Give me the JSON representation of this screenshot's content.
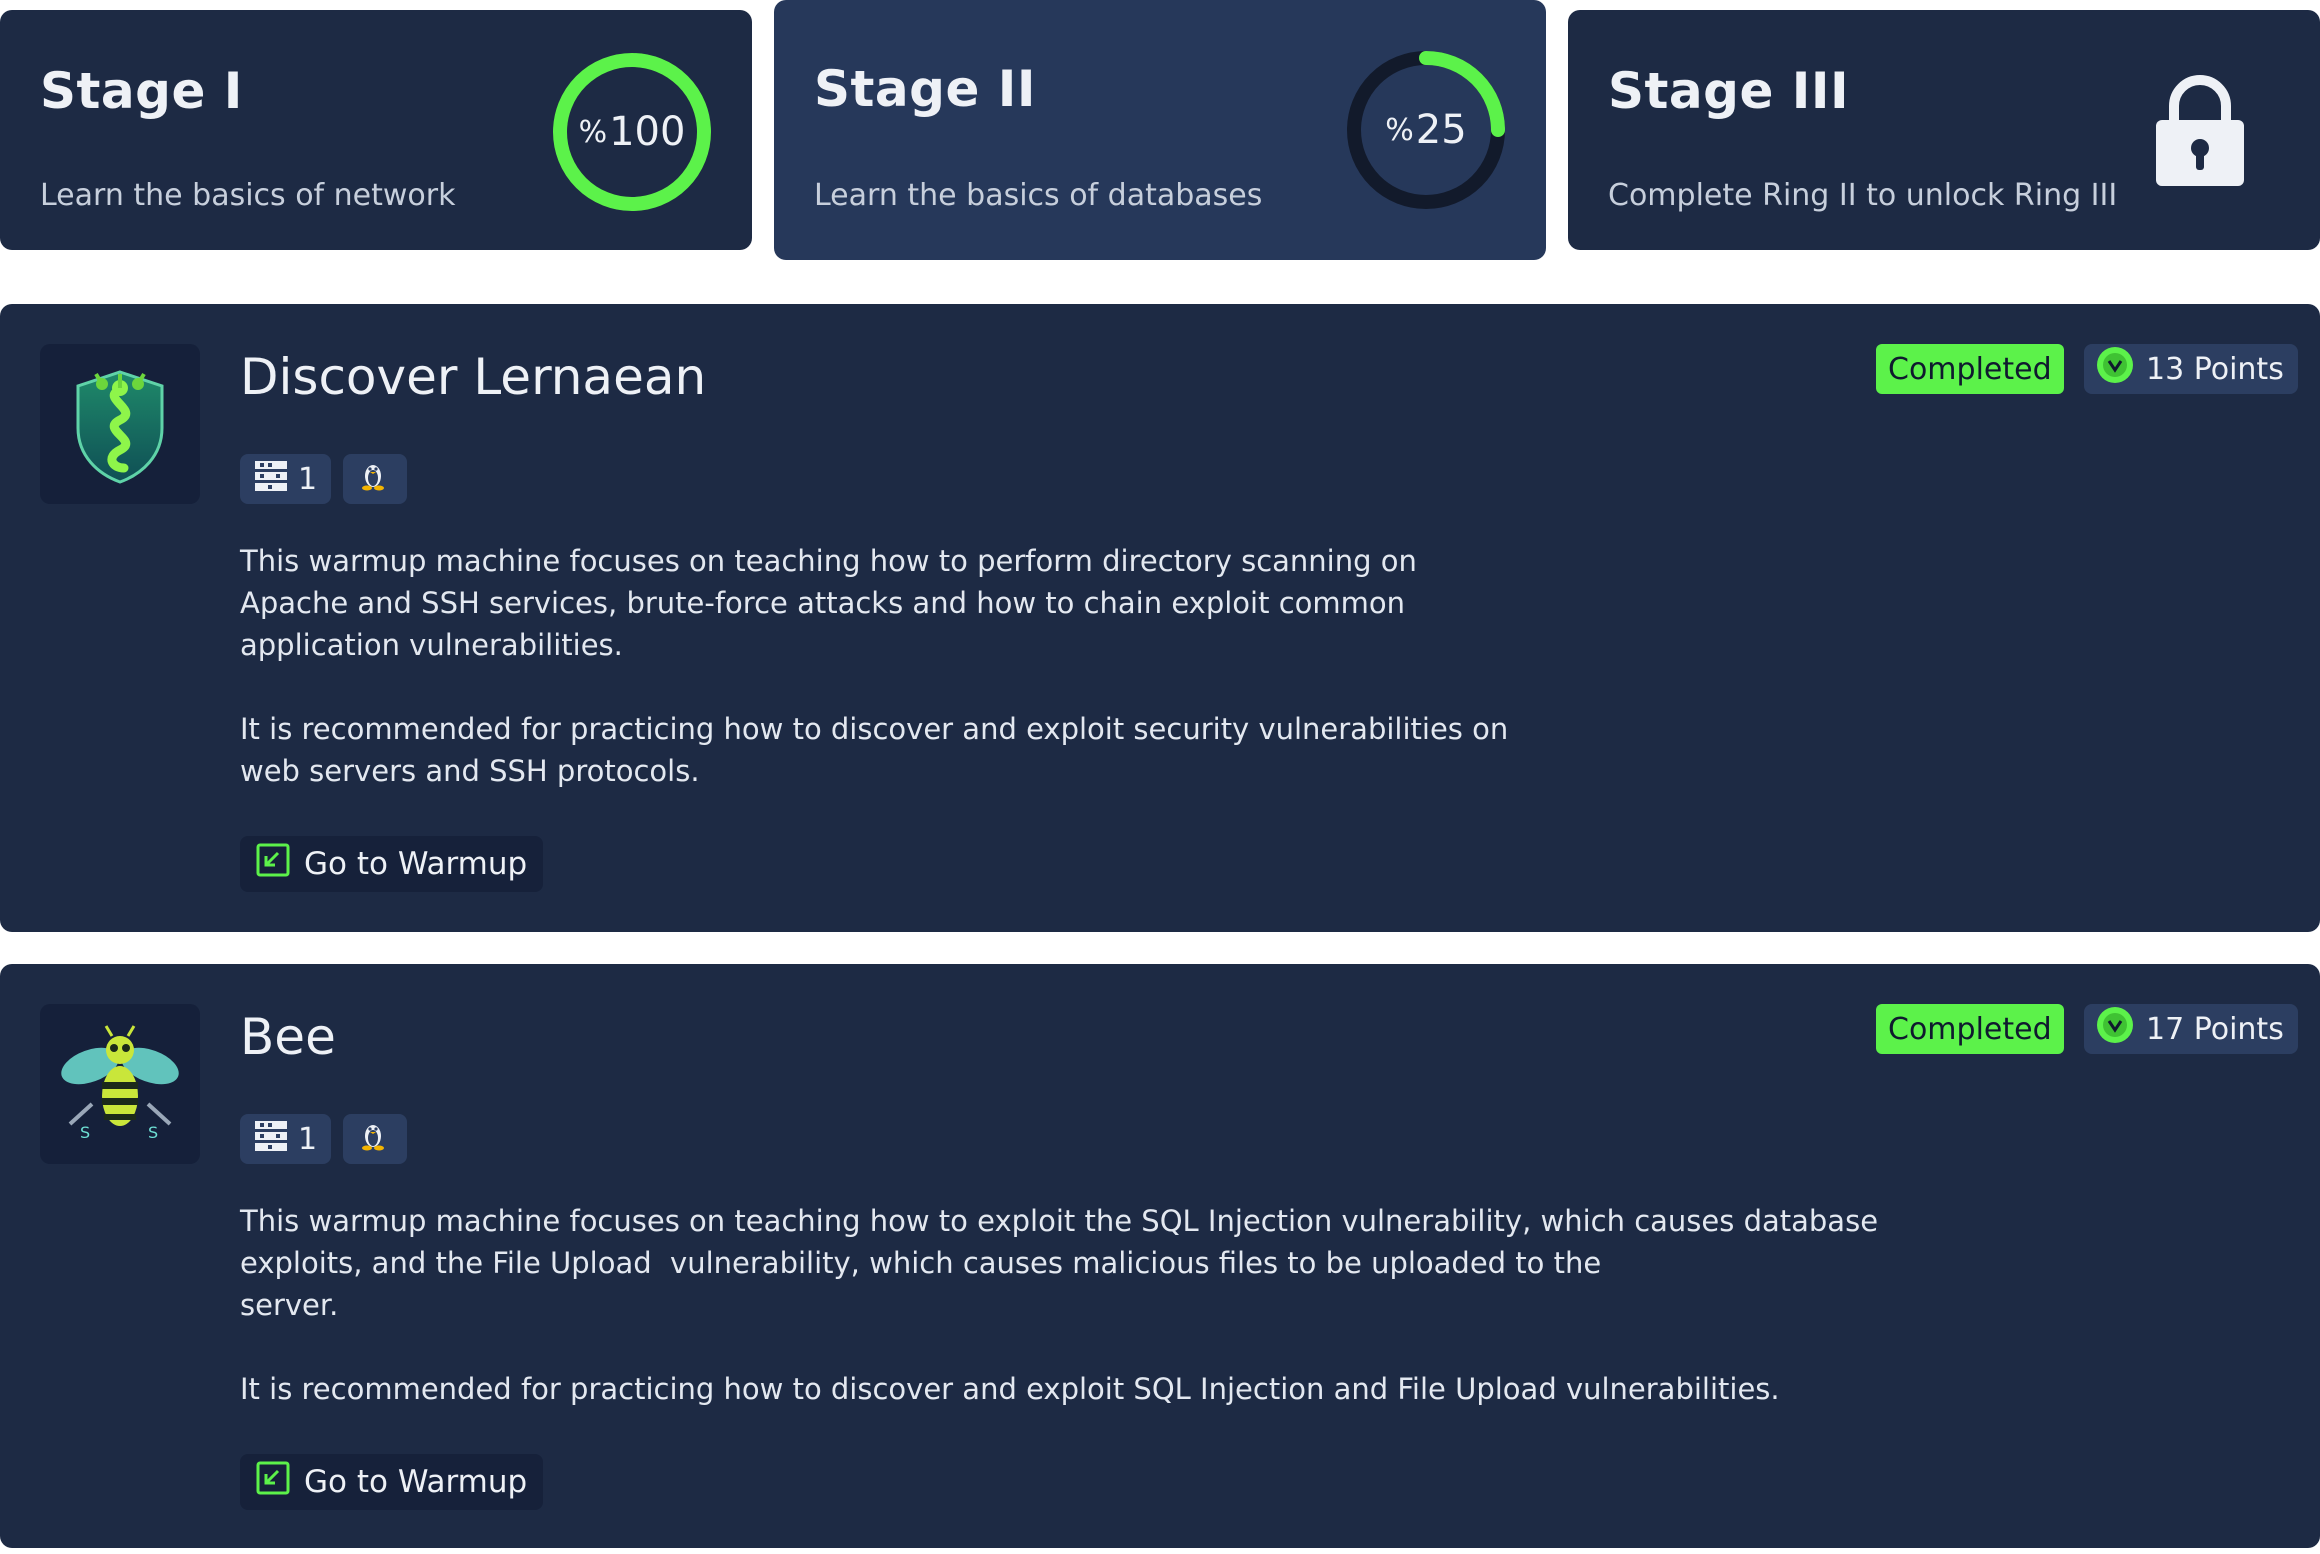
{
  "colors": {
    "card_bg": "#1d2a44",
    "active_card_bg": "#26385a",
    "accent_green": "#5cf24a",
    "ring_track": "#121a2b",
    "tag_bg": "#2c3e61"
  },
  "stages": [
    {
      "title": "Stage I",
      "subtitle": "Learn the basics of network",
      "percent_symbol": "%",
      "percent": "100",
      "progress": 1.0,
      "locked": false,
      "active": false
    },
    {
      "title": "Stage II",
      "subtitle": "Learn the basics of databases",
      "percent_symbol": "%",
      "percent": "25",
      "progress": 0.25,
      "locked": false,
      "active": true
    },
    {
      "title": "Stage III",
      "subtitle": "Complete Ring II to unlock Ring III",
      "locked": true,
      "icon": "lock-icon",
      "active": false
    }
  ],
  "warmups": [
    {
      "title": "Discover Lernaean",
      "logo_icon": "hydra-serpent-shield-logo",
      "machine_count": "1",
      "machine_icon": "server-rack-icon",
      "os_icon": "linux-penguin-icon",
      "status": "Completed",
      "points": "13 Points",
      "points_icon": "check-coin-icon",
      "description": [
        "This warmup machine focuses on teaching how to perform directory scanning on\nApache and SSH services, brute-force attacks and how to chain exploit common\napplication vulnerabilities.",
        "It is recommended for practicing how to discover and exploit security vulnerabilities on\nweb servers and SSH protocols."
      ],
      "button_label": "Go to Warmup",
      "button_icon": "external-link-icon"
    },
    {
      "title": "Bee",
      "logo_icon": "bee-logo",
      "machine_count": "1",
      "machine_icon": "server-rack-icon",
      "os_icon": "linux-penguin-icon",
      "status": "Completed",
      "points": "17 Points",
      "points_icon": "check-coin-icon",
      "description": [
        "This warmup machine focuses on teaching how to exploit the SQL Injection vulnerability, which causes database\nexploits, and the File Upload  vulnerability, which causes malicious files to be uploaded to the\nserver.",
        "It is recommended for practicing how to discover and exploit SQL Injection and File Upload vulnerabilities."
      ],
      "button_label": "Go to Warmup",
      "button_icon": "external-link-icon"
    }
  ]
}
